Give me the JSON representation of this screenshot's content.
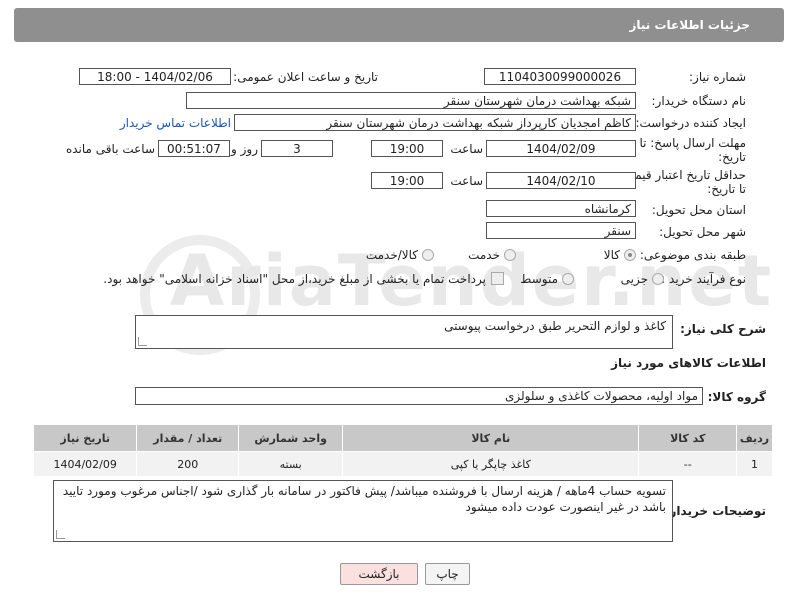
{
  "header": {
    "title": "جزئیات اطلاعات نیاز"
  },
  "form": {
    "need_number_label": "شماره نیاز:",
    "need_number": "1104030099000026",
    "announce_label": "تاریخ و ساعت اعلان عمومی:",
    "announce_value": "1404/02/06 - 18:00",
    "buyer_org_label": "نام دستگاه خریدار:",
    "buyer_org": "شبکه بهداشت درمان شهرستان سنقر",
    "creator_label": "ایجاد کننده درخواست:",
    "creator": "کاظم امجدیان کارپرداز شبکه بهداشت درمان شهرستان سنقر",
    "contact_link": "اطلاعات تماس خریدار",
    "deadline_label_1": "مهلت ارسال پاسخ: تا",
    "deadline_label_2": "تاریخ:",
    "deadline_date": "1404/02/09",
    "time_label": "ساعت",
    "deadline_time": "19:00",
    "days_value": "3",
    "days_label": "روز و",
    "remaining_time": "00:51:07",
    "remaining_label": "ساعت باقی مانده",
    "price_label_1": "حداقل تاریخ اعتبار قیمت:",
    "price_label_2": "تا تاریخ:",
    "price_date": "1404/02/10",
    "price_time": "19:00",
    "province_label": "استان محل تحویل:",
    "province": "کرمانشاه",
    "city_label": "شهر محل تحویل:",
    "city": "سنقر",
    "category_label": "طبقه بندی موضوعی:",
    "category_options": [
      "کالا",
      "خدمت",
      "کالا/خدمت"
    ],
    "category_selected": "کالا",
    "process_label": "نوع فرآیند خرید :",
    "process_options": [
      "جزیی",
      "متوسط"
    ],
    "payment_note": "پرداخت تمام یا بخشی از مبلغ خرید،از محل \"اسناد خزانه اسلامی\" خواهد بود."
  },
  "description": {
    "label": "شرح کلی نیاز:",
    "value": "کاغذ و لوازم التحریر طبق درخواست پیوستی"
  },
  "goods": {
    "section_title": "اطلاعات کالاهای مورد نیاز",
    "group_label": "گروه کالا:",
    "group_value": "مواد اولیه، محصولات کاغذی و سلولزی",
    "columns": [
      "ردیف",
      "کد کالا",
      "نام کالا",
      "واحد شمارش",
      "تعداد / مقدار",
      "تاریخ نیاز"
    ],
    "rows": [
      [
        "1",
        "--",
        "کاغذ چاپگر یا کپی",
        "بسته",
        "200",
        "1404/02/09"
      ]
    ]
  },
  "buyer_notes": {
    "label": "توضیحات خریدار:",
    "value": "تسویه حساب 4ماهه / هزینه ارسال با فروشنده میباشد/ پیش فاکتور در سامانه بار گذاری شود /اجناس مرغوب ومورد تایید باشد در غیر اینصورت عودت داده میشود"
  },
  "buttons": {
    "print": "چاپ",
    "back": "بازگشت"
  },
  "watermark": "AriaTender.net"
}
